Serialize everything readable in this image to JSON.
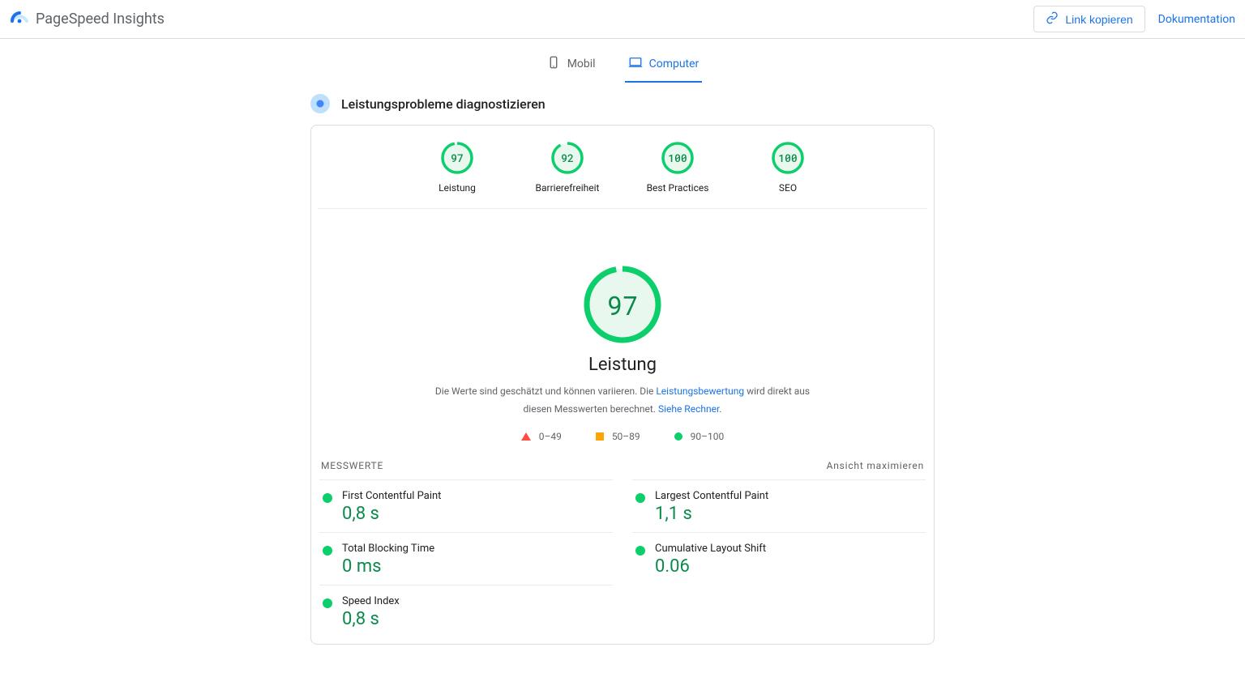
{
  "header": {
    "title": "PageSpeed Insights",
    "copy_link_label": "Link kopieren",
    "documentation_label": "Dokumentation"
  },
  "tabs": {
    "mobile": "Mobil",
    "computer": "Computer",
    "active": "computer"
  },
  "section_title": "Leistungsprobleme diagnostizieren",
  "gauges": [
    {
      "score": 97,
      "label": "Leistung"
    },
    {
      "score": 92,
      "label": "Barrierefreiheit"
    },
    {
      "score": 100,
      "label": "Best Practices"
    },
    {
      "score": 100,
      "label": "SEO"
    }
  ],
  "main_gauge": {
    "score": 97,
    "title": "Leistung",
    "desc_prefix": "Die Werte sind geschätzt und können variieren. Die ",
    "desc_link1": "Leistungsbewertung",
    "desc_mid": " wird direkt aus diesen Messwerten berechnet. ",
    "desc_link2": "Siehe Rechner"
  },
  "legend": {
    "bad": "0–49",
    "mid": "50–89",
    "good": "90–100"
  },
  "metrics_header": {
    "title": "Messwerte",
    "expand": "Ansicht maximieren"
  },
  "metrics": [
    {
      "name": "First Contentful Paint",
      "value": "0,8 s"
    },
    {
      "name": "Largest Contentful Paint",
      "value": "1,1 s"
    },
    {
      "name": "Total Blocking Time",
      "value": "0 ms"
    },
    {
      "name": "Cumulative Layout Shift",
      "value": "0.06"
    },
    {
      "name": "Speed Index",
      "value": "0,8 s"
    }
  ]
}
